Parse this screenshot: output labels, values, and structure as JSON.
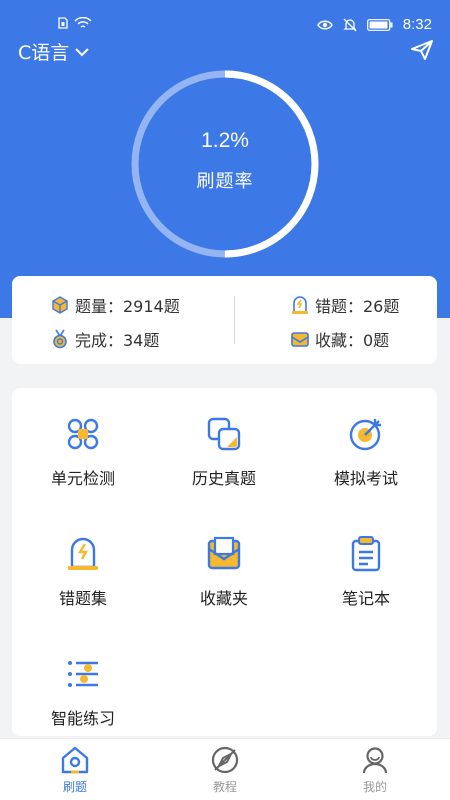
{
  "statusbar": {
    "time": "8:32"
  },
  "header": {
    "subject": "C语言"
  },
  "progress": {
    "percent_text": "1.2%",
    "label": "刷题率",
    "fraction": 0.012
  },
  "stats": {
    "questions": "题量：2914题",
    "done": "完成：34题",
    "wrong": "错题：26题",
    "favorites": "收藏：0题"
  },
  "tiles": [
    {
      "label": "单元检测",
      "icon": "unit-test-icon"
    },
    {
      "label": "历史真题",
      "icon": "past-papers-icon"
    },
    {
      "label": "模拟考试",
      "icon": "mock-exam-icon"
    },
    {
      "label": "错题集",
      "icon": "wrong-set-icon"
    },
    {
      "label": "收藏夹",
      "icon": "favorites-icon"
    },
    {
      "label": "笔记本",
      "icon": "notebook-icon"
    },
    {
      "label": "智能练习",
      "icon": "smart-practice-icon"
    }
  ],
  "nav": [
    {
      "label": "刷题",
      "active": true
    },
    {
      "label": "教程",
      "active": false
    },
    {
      "label": "我的",
      "active": false
    }
  ],
  "colors": {
    "primary": "#3d79e6",
    "accent": "#f5b82e",
    "icon_blue": "#3d79e6"
  }
}
